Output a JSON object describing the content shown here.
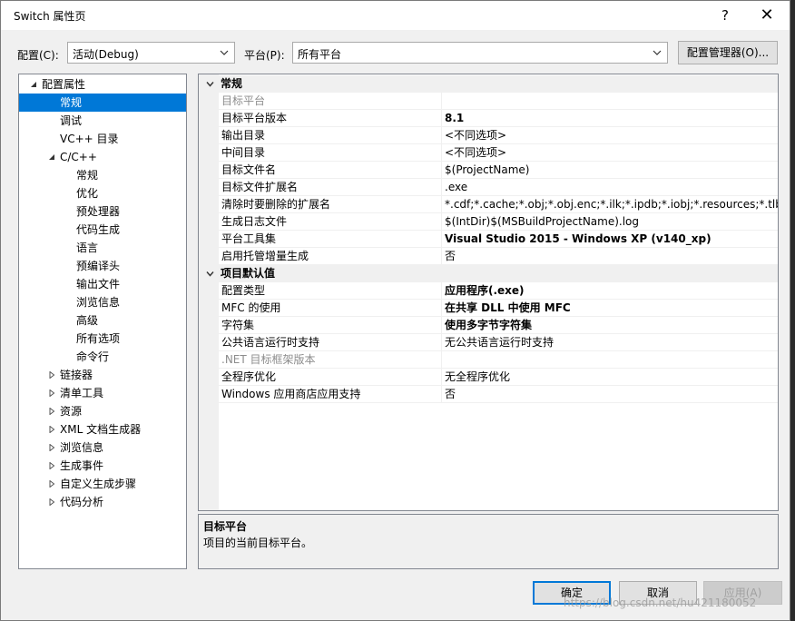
{
  "window": {
    "title": "Switch 属性页",
    "help_label": "?",
    "close_label": "✕"
  },
  "toolbar": {
    "config_label": "配置(C):",
    "config_value": "活动(Debug)",
    "platform_label": "平台(P):",
    "platform_value": "所有平台",
    "config_manager_label": "配置管理器(O)..."
  },
  "tree": {
    "items": [
      {
        "label": "配置属性",
        "level": 0,
        "expander": "expanded"
      },
      {
        "label": "常规",
        "level": 1,
        "expander": "none",
        "selected": true
      },
      {
        "label": "调试",
        "level": 1,
        "expander": "none"
      },
      {
        "label": "VC++ 目录",
        "level": 1,
        "expander": "none"
      },
      {
        "label": "C/C++",
        "level": 1,
        "expander": "expanded"
      },
      {
        "label": "常规",
        "level": 2,
        "expander": "none"
      },
      {
        "label": "优化",
        "level": 2,
        "expander": "none"
      },
      {
        "label": "预处理器",
        "level": 2,
        "expander": "none"
      },
      {
        "label": "代码生成",
        "level": 2,
        "expander": "none"
      },
      {
        "label": "语言",
        "level": 2,
        "expander": "none"
      },
      {
        "label": "预编译头",
        "level": 2,
        "expander": "none"
      },
      {
        "label": "输出文件",
        "level": 2,
        "expander": "none"
      },
      {
        "label": "浏览信息",
        "level": 2,
        "expander": "none"
      },
      {
        "label": "高级",
        "level": 2,
        "expander": "none"
      },
      {
        "label": "所有选项",
        "level": 2,
        "expander": "none"
      },
      {
        "label": "命令行",
        "level": 2,
        "expander": "none"
      },
      {
        "label": "链接器",
        "level": 1,
        "expander": "collapsed"
      },
      {
        "label": "清单工具",
        "level": 1,
        "expander": "collapsed"
      },
      {
        "label": "资源",
        "level": 1,
        "expander": "collapsed"
      },
      {
        "label": "XML 文档生成器",
        "level": 1,
        "expander": "collapsed"
      },
      {
        "label": "浏览信息",
        "level": 1,
        "expander": "collapsed"
      },
      {
        "label": "生成事件",
        "level": 1,
        "expander": "collapsed"
      },
      {
        "label": "自定义生成步骤",
        "level": 1,
        "expander": "collapsed"
      },
      {
        "label": "代码分析",
        "level": 1,
        "expander": "collapsed"
      }
    ]
  },
  "grid": {
    "rows": [
      {
        "type": "category",
        "name": "常规"
      },
      {
        "type": "prop",
        "name": "目标平台",
        "value": "",
        "grey": true,
        "bold": false
      },
      {
        "type": "prop",
        "name": "目标平台版本",
        "value": "8.1",
        "bold": true
      },
      {
        "type": "prop",
        "name": "输出目录",
        "value": "<不同选项>",
        "bold": false
      },
      {
        "type": "prop",
        "name": "中间目录",
        "value": "<不同选项>",
        "bold": false
      },
      {
        "type": "prop",
        "name": "目标文件名",
        "value": "$(ProjectName)",
        "bold": false
      },
      {
        "type": "prop",
        "name": "目标文件扩展名",
        "value": ".exe",
        "bold": false
      },
      {
        "type": "prop",
        "name": "清除时要删除的扩展名",
        "value": "*.cdf;*.cache;*.obj;*.obj.enc;*.ilk;*.ipdb;*.iobj;*.resources;*.tlb;*.tli;*.t",
        "bold": false
      },
      {
        "type": "prop",
        "name": "生成日志文件",
        "value": "$(IntDir)$(MSBuildProjectName).log",
        "bold": false
      },
      {
        "type": "prop",
        "name": "平台工具集",
        "value": "Visual Studio 2015 - Windows XP (v140_xp)",
        "bold": true
      },
      {
        "type": "prop",
        "name": "启用托管增量生成",
        "value": "否",
        "bold": false
      },
      {
        "type": "category",
        "name": "项目默认值"
      },
      {
        "type": "prop",
        "name": "配置类型",
        "value": "应用程序(.exe)",
        "bold": true
      },
      {
        "type": "prop",
        "name": "MFC 的使用",
        "value": "在共享 DLL 中使用 MFC",
        "bold": true
      },
      {
        "type": "prop",
        "name": "字符集",
        "value": "使用多字节字符集",
        "bold": true
      },
      {
        "type": "prop",
        "name": "公共语言运行时支持",
        "value": "无公共语言运行时支持",
        "bold": false
      },
      {
        "type": "prop",
        "name": ".NET 目标框架版本",
        "value": "",
        "grey": true,
        "bold": false
      },
      {
        "type": "prop",
        "name": "全程序优化",
        "value": "无全程序优化",
        "bold": false
      },
      {
        "type": "prop",
        "name": "Windows 应用商店应用支持",
        "value": "否",
        "bold": false
      }
    ]
  },
  "description": {
    "title": "目标平台",
    "text": "项目的当前目标平台。"
  },
  "buttons": {
    "ok": "确定",
    "cancel": "取消",
    "apply": "应用(A)"
  },
  "watermark": "https://blog.csdn.net/hu421180052"
}
